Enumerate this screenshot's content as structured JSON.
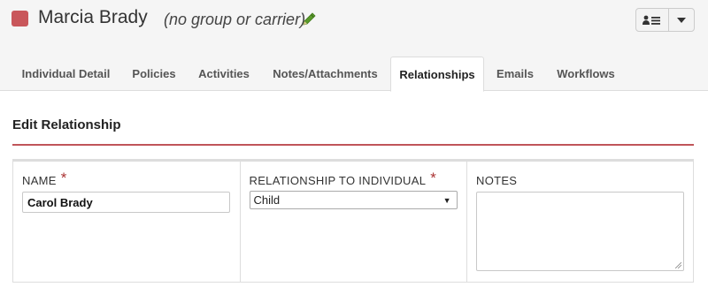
{
  "header": {
    "name": "Marcia Brady",
    "group_text": "(no group or carrier)",
    "color": "#c9575b",
    "edit_icon": "pencil-icon",
    "actions_icon": "contact-list-icon",
    "dropdown_icon": "caret-down-icon"
  },
  "tabs": [
    {
      "label": "Individual Detail",
      "active": false
    },
    {
      "label": "Policies",
      "active": false
    },
    {
      "label": "Activities",
      "active": false
    },
    {
      "label": "Notes/Attachments",
      "active": false
    },
    {
      "label": "Relationships",
      "active": true
    },
    {
      "label": "Emails",
      "active": false
    },
    {
      "label": "Workflows",
      "active": false
    }
  ],
  "section": {
    "title": "Edit Relationship",
    "rule_color": "#c0555a"
  },
  "form": {
    "name_label": "NAME",
    "name_value": "Carol Brady",
    "relationship_label": "RELATIONSHIP TO INDIVIDUAL",
    "relationship_value": "Child",
    "notes_label": "NOTES",
    "notes_value": "",
    "required_mark": "*"
  }
}
